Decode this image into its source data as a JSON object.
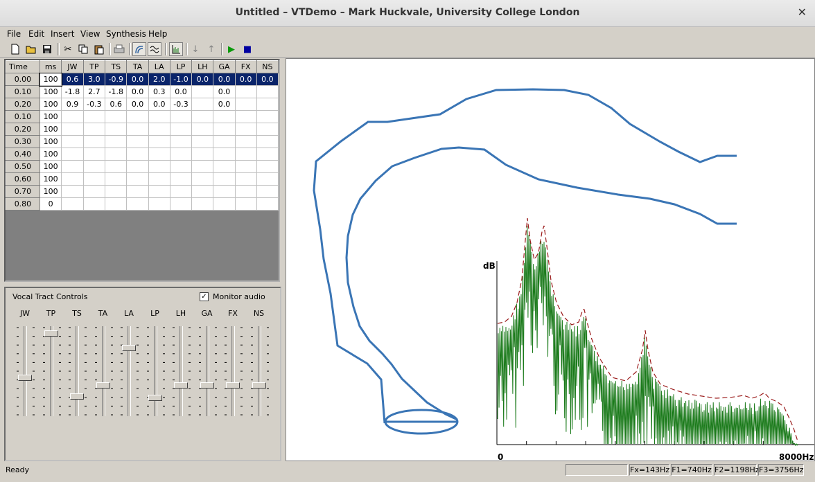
{
  "window": {
    "title": "Untitled – VTDemo – Mark Huckvale, University College London"
  },
  "menu": [
    "File",
    "Edit",
    "Insert",
    "View",
    "Synthesis",
    "Help"
  ],
  "grid": {
    "headers": [
      "Time",
      "ms",
      "JW",
      "TP",
      "TS",
      "TA",
      "LA",
      "LP",
      "LH",
      "GA",
      "FX",
      "NS"
    ],
    "rows": [
      [
        "0.00",
        "100",
        "0.6",
        "3.0",
        "-0.9",
        "0.0",
        "2.0",
        "-1.0",
        "0.0",
        "0.0",
        "0.0",
        "0.0"
      ],
      [
        "0.10",
        "100",
        "-1.8",
        "2.7",
        "-1.8",
        "0.0",
        "0.3",
        "0.0",
        "",
        "0.0",
        "",
        ""
      ],
      [
        "0.20",
        "100",
        "0.9",
        "-0.3",
        "0.6",
        "0.0",
        "0.0",
        "-0.3",
        "",
        "0.0",
        "",
        ""
      ],
      [
        "0.10",
        "100",
        "",
        "",
        "",
        "",
        "",
        "",
        "",
        "",
        "",
        ""
      ],
      [
        "0.20",
        "100",
        "",
        "",
        "",
        "",
        "",
        "",
        "",
        "",
        "",
        ""
      ],
      [
        "0.30",
        "100",
        "",
        "",
        "",
        "",
        "",
        "",
        "",
        "",
        "",
        ""
      ],
      [
        "0.40",
        "100",
        "",
        "",
        "",
        "",
        "",
        "",
        "",
        "",
        "",
        ""
      ],
      [
        "0.50",
        "100",
        "",
        "",
        "",
        "",
        "",
        "",
        "",
        "",
        "",
        ""
      ],
      [
        "0.60",
        "100",
        "",
        "",
        "",
        "",
        "",
        "",
        "",
        "",
        "",
        ""
      ],
      [
        "0.70",
        "100",
        "",
        "",
        "",
        "",
        "",
        "",
        "",
        "",
        "",
        ""
      ],
      [
        "0.80",
        "0",
        "",
        "",
        "",
        "",
        "",
        "",
        "",
        "",
        "",
        ""
      ]
    ]
  },
  "controls": {
    "title": "Vocal Tract Controls",
    "monitor_label": "Monitor audio",
    "monitor_checked": "✓",
    "sliders": [
      {
        "label": "JW",
        "level": 0.42
      },
      {
        "label": "TP",
        "level": 0.95
      },
      {
        "label": "TS",
        "level": 0.2
      },
      {
        "label": "TA",
        "level": 0.33
      },
      {
        "label": "LA",
        "level": 0.78
      },
      {
        "label": "LP",
        "level": 0.18
      },
      {
        "label": "LH",
        "level": 0.33
      },
      {
        "label": "GA",
        "level": 0.33
      },
      {
        "label": "FX",
        "level": 0.33
      },
      {
        "label": "NS",
        "level": 0.33
      }
    ]
  },
  "spectrum": {
    "y_label": "dB",
    "x_min": "0",
    "x_max": "8000Hz"
  },
  "status": {
    "text": "Ready",
    "fx": "Fx=143Hz",
    "f1": "F1=740Hz",
    "f2": "F2=1198Hz",
    "f3": "F3=3756Hz"
  },
  "colors": {
    "tract": "#3a75b5",
    "harmonics": "#1a7a1a",
    "envelope": "#9b1c1c",
    "selection": "#0a246a"
  },
  "icons": [
    "new-file-icon",
    "open-folder-icon",
    "save-icon",
    "cut-icon",
    "copy-icon",
    "paste-icon",
    "print-icon",
    "tract-view-icon",
    "wave-view-icon",
    "spectrum-view-icon",
    "move-down-icon",
    "move-up-icon",
    "play-icon",
    "stop-icon"
  ]
}
